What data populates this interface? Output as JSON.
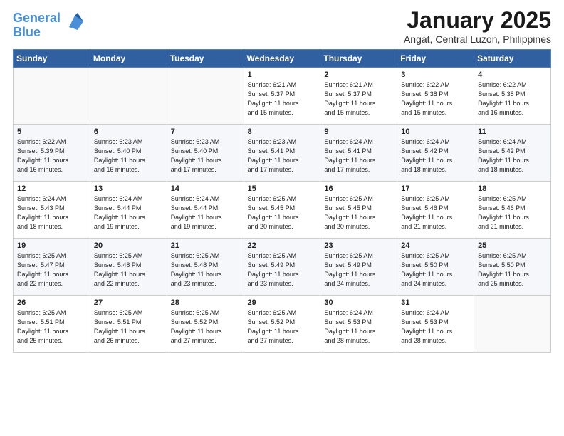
{
  "header": {
    "logo_line1": "General",
    "logo_line2": "Blue",
    "month": "January 2025",
    "location": "Angat, Central Luzon, Philippines"
  },
  "weekdays": [
    "Sunday",
    "Monday",
    "Tuesday",
    "Wednesday",
    "Thursday",
    "Friday",
    "Saturday"
  ],
  "weeks": [
    [
      {
        "day": "",
        "info": ""
      },
      {
        "day": "",
        "info": ""
      },
      {
        "day": "",
        "info": ""
      },
      {
        "day": "1",
        "info": "Sunrise: 6:21 AM\nSunset: 5:37 PM\nDaylight: 11 hours\nand 15 minutes."
      },
      {
        "day": "2",
        "info": "Sunrise: 6:21 AM\nSunset: 5:37 PM\nDaylight: 11 hours\nand 15 minutes."
      },
      {
        "day": "3",
        "info": "Sunrise: 6:22 AM\nSunset: 5:38 PM\nDaylight: 11 hours\nand 15 minutes."
      },
      {
        "day": "4",
        "info": "Sunrise: 6:22 AM\nSunset: 5:38 PM\nDaylight: 11 hours\nand 16 minutes."
      }
    ],
    [
      {
        "day": "5",
        "info": "Sunrise: 6:22 AM\nSunset: 5:39 PM\nDaylight: 11 hours\nand 16 minutes."
      },
      {
        "day": "6",
        "info": "Sunrise: 6:23 AM\nSunset: 5:40 PM\nDaylight: 11 hours\nand 16 minutes."
      },
      {
        "day": "7",
        "info": "Sunrise: 6:23 AM\nSunset: 5:40 PM\nDaylight: 11 hours\nand 17 minutes."
      },
      {
        "day": "8",
        "info": "Sunrise: 6:23 AM\nSunset: 5:41 PM\nDaylight: 11 hours\nand 17 minutes."
      },
      {
        "day": "9",
        "info": "Sunrise: 6:24 AM\nSunset: 5:41 PM\nDaylight: 11 hours\nand 17 minutes."
      },
      {
        "day": "10",
        "info": "Sunrise: 6:24 AM\nSunset: 5:42 PM\nDaylight: 11 hours\nand 18 minutes."
      },
      {
        "day": "11",
        "info": "Sunrise: 6:24 AM\nSunset: 5:42 PM\nDaylight: 11 hours\nand 18 minutes."
      }
    ],
    [
      {
        "day": "12",
        "info": "Sunrise: 6:24 AM\nSunset: 5:43 PM\nDaylight: 11 hours\nand 18 minutes."
      },
      {
        "day": "13",
        "info": "Sunrise: 6:24 AM\nSunset: 5:44 PM\nDaylight: 11 hours\nand 19 minutes."
      },
      {
        "day": "14",
        "info": "Sunrise: 6:24 AM\nSunset: 5:44 PM\nDaylight: 11 hours\nand 19 minutes."
      },
      {
        "day": "15",
        "info": "Sunrise: 6:25 AM\nSunset: 5:45 PM\nDaylight: 11 hours\nand 20 minutes."
      },
      {
        "day": "16",
        "info": "Sunrise: 6:25 AM\nSunset: 5:45 PM\nDaylight: 11 hours\nand 20 minutes."
      },
      {
        "day": "17",
        "info": "Sunrise: 6:25 AM\nSunset: 5:46 PM\nDaylight: 11 hours\nand 21 minutes."
      },
      {
        "day": "18",
        "info": "Sunrise: 6:25 AM\nSunset: 5:46 PM\nDaylight: 11 hours\nand 21 minutes."
      }
    ],
    [
      {
        "day": "19",
        "info": "Sunrise: 6:25 AM\nSunset: 5:47 PM\nDaylight: 11 hours\nand 22 minutes."
      },
      {
        "day": "20",
        "info": "Sunrise: 6:25 AM\nSunset: 5:48 PM\nDaylight: 11 hours\nand 22 minutes."
      },
      {
        "day": "21",
        "info": "Sunrise: 6:25 AM\nSunset: 5:48 PM\nDaylight: 11 hours\nand 23 minutes."
      },
      {
        "day": "22",
        "info": "Sunrise: 6:25 AM\nSunset: 5:49 PM\nDaylight: 11 hours\nand 23 minutes."
      },
      {
        "day": "23",
        "info": "Sunrise: 6:25 AM\nSunset: 5:49 PM\nDaylight: 11 hours\nand 24 minutes."
      },
      {
        "day": "24",
        "info": "Sunrise: 6:25 AM\nSunset: 5:50 PM\nDaylight: 11 hours\nand 24 minutes."
      },
      {
        "day": "25",
        "info": "Sunrise: 6:25 AM\nSunset: 5:50 PM\nDaylight: 11 hours\nand 25 minutes."
      }
    ],
    [
      {
        "day": "26",
        "info": "Sunrise: 6:25 AM\nSunset: 5:51 PM\nDaylight: 11 hours\nand 25 minutes."
      },
      {
        "day": "27",
        "info": "Sunrise: 6:25 AM\nSunset: 5:51 PM\nDaylight: 11 hours\nand 26 minutes."
      },
      {
        "day": "28",
        "info": "Sunrise: 6:25 AM\nSunset: 5:52 PM\nDaylight: 11 hours\nand 27 minutes."
      },
      {
        "day": "29",
        "info": "Sunrise: 6:25 AM\nSunset: 5:52 PM\nDaylight: 11 hours\nand 27 minutes."
      },
      {
        "day": "30",
        "info": "Sunrise: 6:24 AM\nSunset: 5:53 PM\nDaylight: 11 hours\nand 28 minutes."
      },
      {
        "day": "31",
        "info": "Sunrise: 6:24 AM\nSunset: 5:53 PM\nDaylight: 11 hours\nand 28 minutes."
      },
      {
        "day": "",
        "info": ""
      }
    ]
  ]
}
